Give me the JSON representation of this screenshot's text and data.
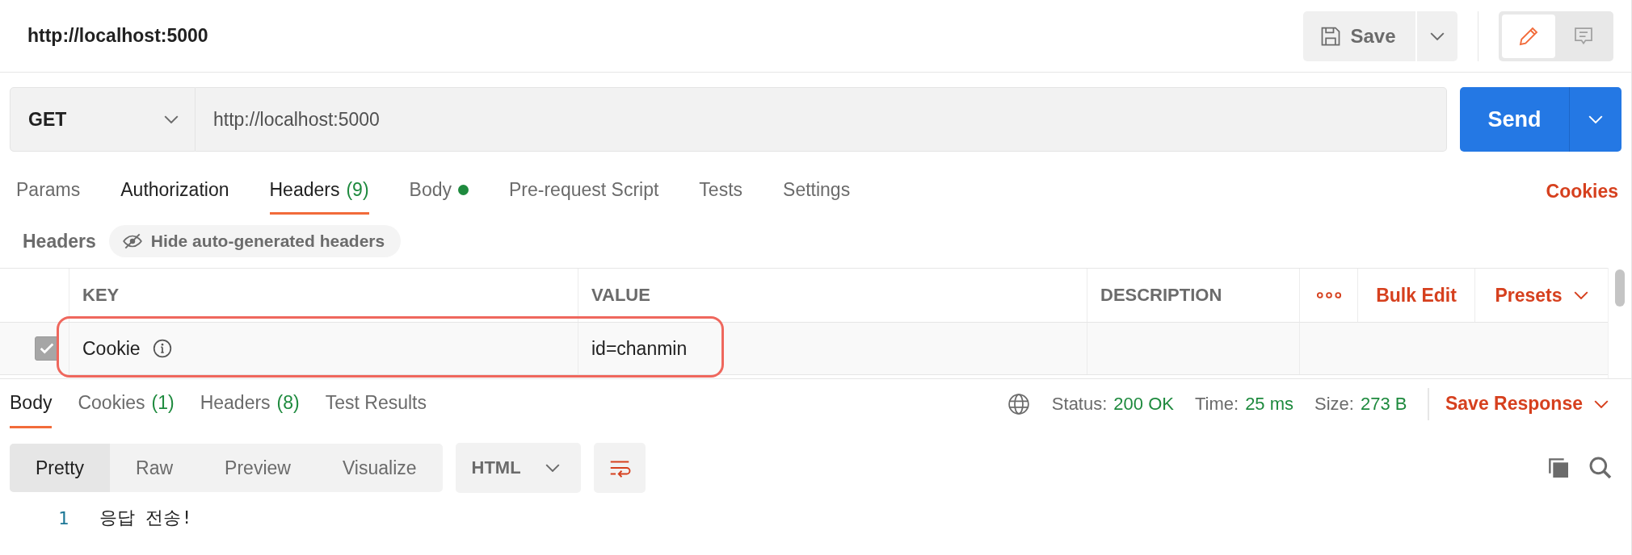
{
  "title": "http://localhost:5000",
  "save": {
    "label": "Save"
  },
  "mode_toggle": [
    {
      "kind": "edit",
      "selected": true
    },
    {
      "kind": "comments",
      "selected": false
    }
  ],
  "request": {
    "method": "GET",
    "url": "http://localhost:5000",
    "send": "Send"
  },
  "request_tabs": [
    {
      "label": "Params",
      "selected": false,
      "has_content": false
    },
    {
      "label": "Authorization",
      "selected": false,
      "has_content": true
    },
    {
      "label": "Headers",
      "count": "(9)",
      "selected": true,
      "has_content": true
    },
    {
      "label": "Body",
      "dot": true,
      "selected": false,
      "has_content": false
    },
    {
      "label": "Pre-request Script",
      "selected": false,
      "has_content": false
    },
    {
      "label": "Tests",
      "selected": false,
      "has_content": false
    },
    {
      "label": "Settings",
      "selected": false,
      "has_content": false
    }
  ],
  "cookies_link": "Cookies",
  "headers_bar": {
    "label": "Headers",
    "toggle": "Hide auto-generated headers"
  },
  "table": {
    "columns": [
      "KEY",
      "VALUE",
      "DESCRIPTION"
    ],
    "actions": [
      "Bulk Edit",
      "Presets"
    ],
    "rows": [
      {
        "checked": true,
        "key": "Cookie",
        "value": "id=chanmin",
        "highlighted": true
      }
    ]
  },
  "response_tabs": [
    {
      "label": "Body",
      "selected": true
    },
    {
      "label": "Cookies",
      "count": "(1)",
      "selected": false
    },
    {
      "label": "Headers",
      "count": "(8)",
      "selected": false
    },
    {
      "label": "Test Results",
      "selected": false
    }
  ],
  "status": [
    {
      "label": "Status:",
      "value": "200 OK"
    },
    {
      "label": "Time:",
      "value": "25 ms"
    },
    {
      "label": "Size:",
      "value": "273 B"
    }
  ],
  "save_response": "Save Response",
  "view_modes": [
    {
      "label": "Pretty",
      "selected": true
    },
    {
      "label": "Raw",
      "selected": false
    },
    {
      "label": "Preview",
      "selected": false
    },
    {
      "label": "Visualize",
      "selected": false
    }
  ],
  "language": "HTML",
  "wrap_lines": true,
  "code_lines": [
    {
      "number": "1",
      "text": "응답 전송!"
    }
  ]
}
